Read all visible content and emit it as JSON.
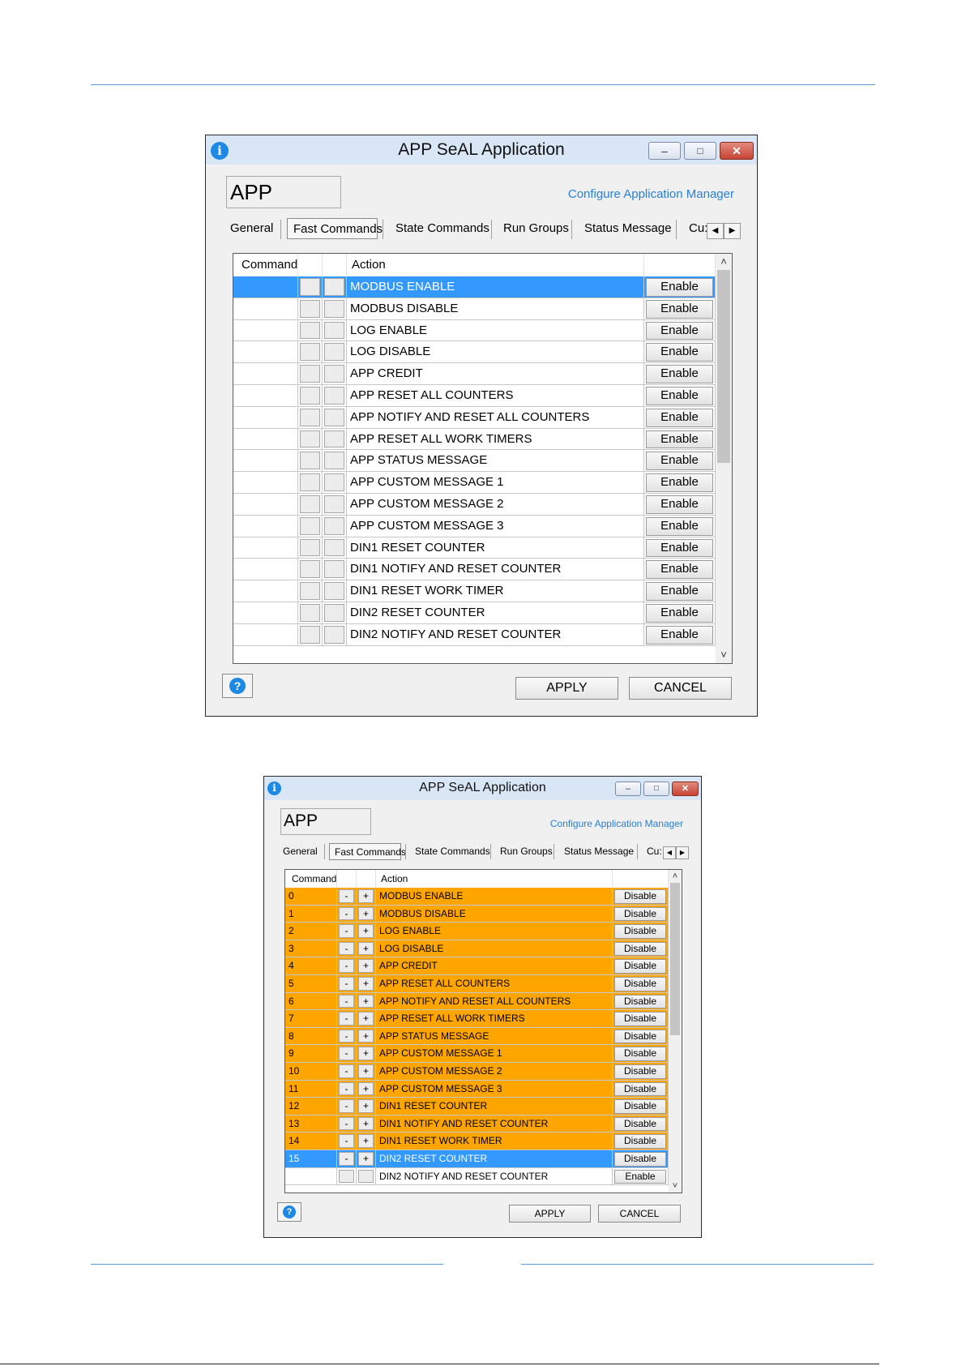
{
  "window1": {
    "title": "APP SeAL Application",
    "app_name": "APP",
    "config_link": "Configure Application Manager",
    "tabs": [
      "General",
      "Fast Commands",
      "State Commands",
      "Run Groups",
      "Status Message",
      "Cu:"
    ],
    "selected_tab": "Fast Commands",
    "columns": {
      "command": "Command",
      "action": "Action"
    },
    "rows": [
      {
        "command": "",
        "minus": "",
        "plus": "",
        "action": "MODBUS ENABLE",
        "button": "Enable",
        "state": "selected"
      },
      {
        "command": "",
        "minus": "",
        "plus": "",
        "action": "MODBUS DISABLE",
        "button": "Enable",
        "state": "normal"
      },
      {
        "command": "",
        "minus": "",
        "plus": "",
        "action": "LOG ENABLE",
        "button": "Enable",
        "state": "normal"
      },
      {
        "command": "",
        "minus": "",
        "plus": "",
        "action": "LOG DISABLE",
        "button": "Enable",
        "state": "normal"
      },
      {
        "command": "",
        "minus": "",
        "plus": "",
        "action": "APP CREDIT",
        "button": "Enable",
        "state": "normal"
      },
      {
        "command": "",
        "minus": "",
        "plus": "",
        "action": "APP RESET ALL COUNTERS",
        "button": "Enable",
        "state": "normal"
      },
      {
        "command": "",
        "minus": "",
        "plus": "",
        "action": "APP NOTIFY AND RESET ALL COUNTERS",
        "button": "Enable",
        "state": "normal"
      },
      {
        "command": "",
        "minus": "",
        "plus": "",
        "action": "APP RESET ALL WORK TIMERS",
        "button": "Enable",
        "state": "normal"
      },
      {
        "command": "",
        "minus": "",
        "plus": "",
        "action": "APP STATUS MESSAGE",
        "button": "Enable",
        "state": "normal"
      },
      {
        "command": "",
        "minus": "",
        "plus": "",
        "action": "APP CUSTOM MESSAGE 1",
        "button": "Enable",
        "state": "normal"
      },
      {
        "command": "",
        "minus": "",
        "plus": "",
        "action": "APP CUSTOM MESSAGE 2",
        "button": "Enable",
        "state": "normal"
      },
      {
        "command": "",
        "minus": "",
        "plus": "",
        "action": "APP CUSTOM MESSAGE 3",
        "button": "Enable",
        "state": "normal"
      },
      {
        "command": "",
        "minus": "",
        "plus": "",
        "action": "DIN1 RESET COUNTER",
        "button": "Enable",
        "state": "normal"
      },
      {
        "command": "",
        "minus": "",
        "plus": "",
        "action": "DIN1 NOTIFY AND RESET COUNTER",
        "button": "Enable",
        "state": "normal"
      },
      {
        "command": "",
        "minus": "",
        "plus": "",
        "action": "DIN1 RESET WORK TIMER",
        "button": "Enable",
        "state": "normal"
      },
      {
        "command": "",
        "minus": "",
        "plus": "",
        "action": "DIN2 RESET COUNTER",
        "button": "Enable",
        "state": "normal"
      },
      {
        "command": "",
        "minus": "",
        "plus": "",
        "action": "DIN2 NOTIFY AND RESET COUNTER",
        "button": "Enable",
        "state": "partial"
      }
    ],
    "buttons": {
      "apply": "APPLY",
      "cancel": "CANCEL"
    }
  },
  "window2": {
    "title": "APP SeAL Application",
    "app_name": "APP",
    "config_link": "Configure Application Manager",
    "tabs": [
      "General",
      "Fast Commands",
      "State Commands",
      "Run Groups",
      "Status Message",
      "Cu:"
    ],
    "selected_tab": "Fast Commands",
    "columns": {
      "command": "Command",
      "action": "Action"
    },
    "rows": [
      {
        "command": "0",
        "minus": "-",
        "plus": "+",
        "action": "MODBUS ENABLE",
        "button": "Disable",
        "state": "active"
      },
      {
        "command": "1",
        "minus": "-",
        "plus": "+",
        "action": "MODBUS DISABLE",
        "button": "Disable",
        "state": "active"
      },
      {
        "command": "2",
        "minus": "-",
        "plus": "+",
        "action": "LOG ENABLE",
        "button": "Disable",
        "state": "active"
      },
      {
        "command": "3",
        "minus": "-",
        "plus": "+",
        "action": "LOG DISABLE",
        "button": "Disable",
        "state": "active"
      },
      {
        "command": "4",
        "minus": "-",
        "plus": "+",
        "action": "APP CREDIT",
        "button": "Disable",
        "state": "active"
      },
      {
        "command": "5",
        "minus": "-",
        "plus": "+",
        "action": "APP RESET ALL COUNTERS",
        "button": "Disable",
        "state": "active"
      },
      {
        "command": "6",
        "minus": "-",
        "plus": "+",
        "action": "APP NOTIFY AND RESET ALL COUNTERS",
        "button": "Disable",
        "state": "active"
      },
      {
        "command": "7",
        "minus": "-",
        "plus": "+",
        "action": "APP RESET ALL WORK TIMERS",
        "button": "Disable",
        "state": "active"
      },
      {
        "command": "8",
        "minus": "-",
        "plus": "+",
        "action": "APP STATUS MESSAGE",
        "button": "Disable",
        "state": "active"
      },
      {
        "command": "9",
        "minus": "-",
        "plus": "+",
        "action": "APP CUSTOM MESSAGE 1",
        "button": "Disable",
        "state": "active"
      },
      {
        "command": "10",
        "minus": "-",
        "plus": "+",
        "action": "APP CUSTOM MESSAGE 2",
        "button": "Disable",
        "state": "active"
      },
      {
        "command": "11",
        "minus": "-",
        "plus": "+",
        "action": "APP CUSTOM MESSAGE 3",
        "button": "Disable",
        "state": "active"
      },
      {
        "command": "12",
        "minus": "-",
        "plus": "+",
        "action": "DIN1 RESET COUNTER",
        "button": "Disable",
        "state": "active"
      },
      {
        "command": "13",
        "minus": "-",
        "plus": "+",
        "action": "DIN1 NOTIFY AND RESET COUNTER",
        "button": "Disable",
        "state": "active"
      },
      {
        "command": "14",
        "minus": "-",
        "plus": "+",
        "action": "DIN1 RESET WORK TIMER",
        "button": "Disable",
        "state": "active"
      },
      {
        "command": "15",
        "minus": "-",
        "plus": "+",
        "action": "DIN2 RESET COUNTER",
        "button": "Disable",
        "state": "selected"
      },
      {
        "command": "",
        "minus": "",
        "plus": "",
        "action": "DIN2 NOTIFY AND RESET COUNTER",
        "button": "Enable",
        "state": "partial"
      }
    ],
    "buttons": {
      "apply": "APPLY",
      "cancel": "CANCEL"
    }
  },
  "colors": {
    "selected_row": "#3399ff",
    "active_row": "#ffa500",
    "link": "#2a7fd4",
    "page_rule": "#5b9bd5"
  },
  "icons": {
    "window_icon": "info-icon",
    "help": "help-icon",
    "minimize": "minimize-icon",
    "maximize": "maximize-icon",
    "close": "close-icon",
    "scroll_up": "chevron-up-icon",
    "scroll_down": "chevron-down-icon",
    "tab_left": "arrow-left-icon",
    "tab_right": "arrow-right-icon"
  }
}
